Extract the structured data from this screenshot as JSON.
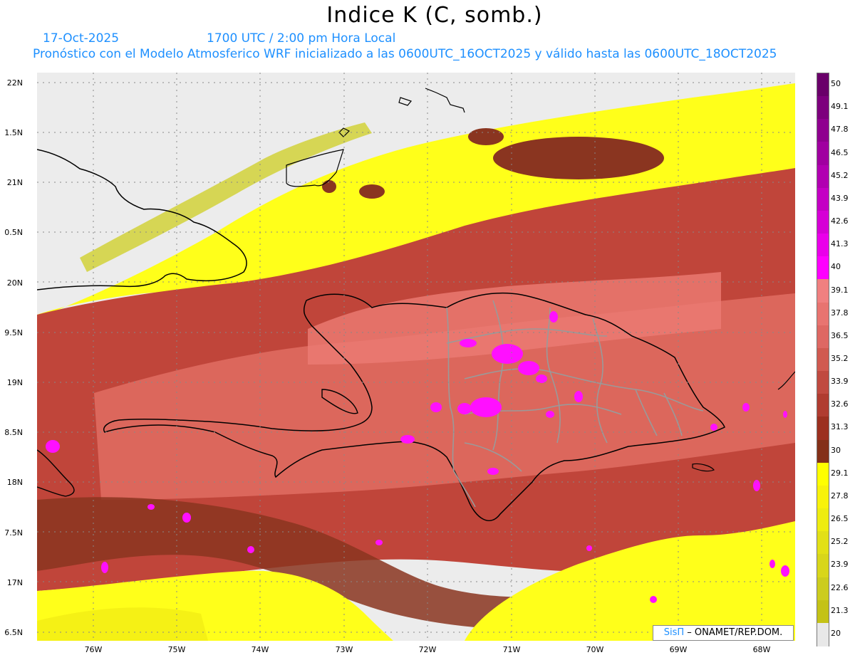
{
  "header": {
    "title": "Indice K (C, somb.)",
    "date": "17-Oct-2025",
    "time": "1700 UTC / 2:00 pm Hora Local",
    "forecast": "Pronóstico con el Modelo Atmosferico WRF inicializado a las 0600UTC_16OCT2025 y válido hasta las  0600UTC_18OCT2025"
  },
  "axes": {
    "lat_labels": [
      "22N",
      "1.5N",
      "21N",
      "0.5N",
      "20N",
      "9.5N",
      "19N",
      "8.5N",
      "18N",
      "7.5N",
      "17N",
      "6.5N"
    ],
    "lon_labels": [
      "76W",
      "75W",
      "74W",
      "73W",
      "72W",
      "71W",
      "70W",
      "69W",
      "68W"
    ]
  },
  "colorbar": {
    "labels": [
      "50",
      "49.1",
      "47.8",
      "46.5",
      "45.2",
      "43.9",
      "42.6",
      "41.3",
      "40",
      "39.1",
      "37.8",
      "36.5",
      "35.2",
      "33.9",
      "32.6",
      "31.3",
      "30",
      "29.1",
      "27.8",
      "26.5",
      "25.2",
      "23.9",
      "22.6",
      "21.3",
      "20"
    ],
    "colors": [
      "#6a006a",
      "#7d007d",
      "#8f008f",
      "#a000a0",
      "#b100b1",
      "#c400c4",
      "#d600d6",
      "#ea00ea",
      "#ff00ff",
      "#f08080",
      "#e87470",
      "#de6863",
      "#d05a50",
      "#c04a40",
      "#b03c30",
      "#9c3020",
      "#843018",
      "#ffff00",
      "#f8f20a",
      "#eeec10",
      "#e2e016",
      "#d8d61a",
      "#cccc1e",
      "#c4c216",
      "#e8e8e8"
    ]
  },
  "credit": {
    "sis": "SisΠ",
    "rest": " – ONAMET/REP.DOM."
  }
}
